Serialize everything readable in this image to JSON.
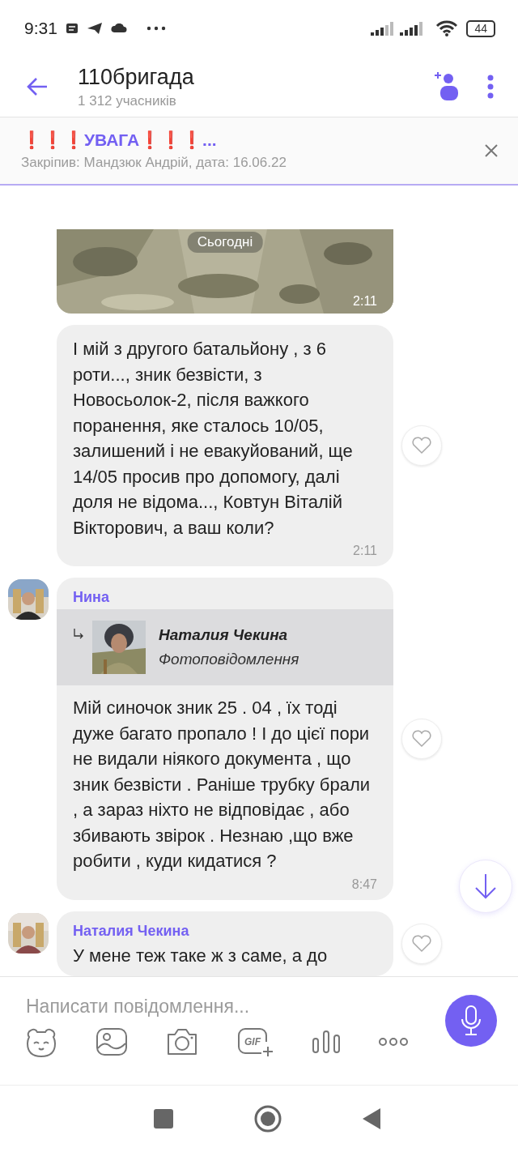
{
  "status_bar": {
    "time": "9:31",
    "battery": "44"
  },
  "header": {
    "title": "110бригада",
    "subtitle": "1 312 учасників"
  },
  "pinned": {
    "prefix": "❗❗❗",
    "title": "УВАГА",
    "suffix": "❗❗❗",
    "ellipsis": "...",
    "info": "Закріпив: Мандзюк Андрій, дата: 16.06.22"
  },
  "chat": {
    "date_chip": "Сьогодні",
    "messages": [
      {
        "time": "2:11"
      },
      {
        "kind": "text",
        "text": "І мій з другого батальйону , з 6 роти..., зник безвісти, з Новосьолок-2, після важкого поранення, яке сталось 10/05, залишений і не евакуйований, ще 14/05 просив про допомогу, далі доля не відома..., Ковтун Віталій Вікторович, а ваш коли?",
        "time": "2:11",
        "liked": false
      },
      {
        "kind": "text",
        "author": "Нина",
        "reply": {
          "author": "Наталия Чекина",
          "text": "Фотоповідомлення"
        },
        "text": "Мій синочок зник 25 . 04 , їх тоді дуже багато пропало ! І до цієї пори не видали ніякого документа , що зник безвісти . Раніше трубку брали , а зараз ніхто не відповідає , або збивають звірок . Незнаю ,що вже робити , куди кидатися ?",
        "time": "8:47",
        "liked": false
      },
      {
        "kind": "text",
        "author": "Наталия Чекина",
        "text": "У мене теж таке ж з саме, а до",
        "liked": false
      }
    ]
  },
  "composer": {
    "placeholder": "Написати повідомлення...",
    "gif_label": "GIF"
  }
}
